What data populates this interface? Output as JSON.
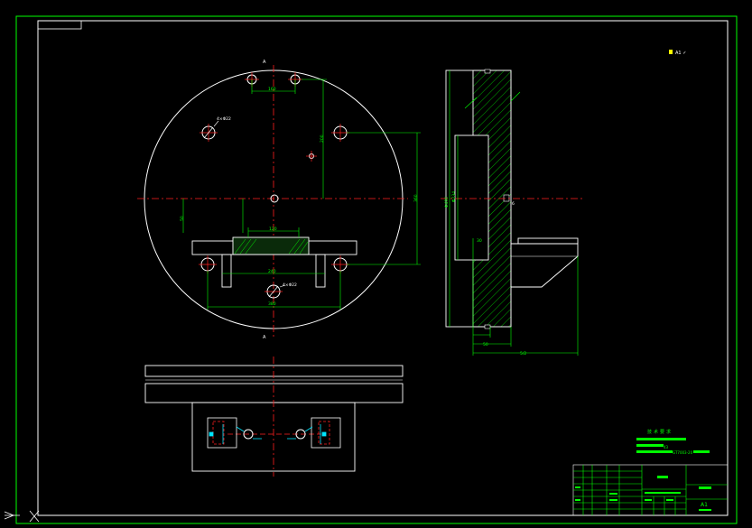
{
  "section_marks": {
    "top": "A",
    "bottom": "A"
  },
  "corner_note": "A1 ✓",
  "dims": {
    "top_hole_spacing": "160",
    "vert_offset": "200",
    "overall_height": "360",
    "slot_width": "120",
    "left_offset": "50",
    "hole_span_inner": "240",
    "base_span": "380",
    "hole_label_left": "4×Φ22",
    "hole_label_bottom": "4×Φ22",
    "side_dia_outer": "Φ490",
    "side_dia_inner": "Φ234",
    "side_depth": "30",
    "side_small": "50",
    "side_overall": "5/2",
    "side_edge": "6"
  },
  "tech_req": {
    "title": "技术要求",
    "lines": [
      "",
      "43",
      "GT7003-20"
    ]
  },
  "title_block": {
    "sheet": "A1"
  },
  "colors": {
    "line": "#ffffff",
    "center": "#ff2020",
    "dim": "#00ff00",
    "hatch": "#00ff00",
    "cyan": "#00e5ff",
    "frame": "#ffffff"
  }
}
